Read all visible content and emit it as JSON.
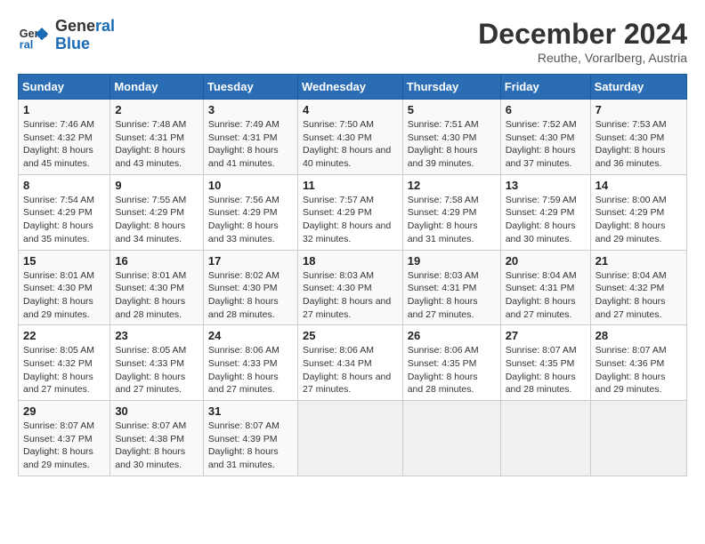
{
  "logo": {
    "line1": "General",
    "line2": "Blue"
  },
  "title": "December 2024",
  "subtitle": "Reuthe, Vorarlberg, Austria",
  "days_of_week": [
    "Sunday",
    "Monday",
    "Tuesday",
    "Wednesday",
    "Thursday",
    "Friday",
    "Saturday"
  ],
  "weeks": [
    [
      {
        "day": "1",
        "sunrise": "7:46 AM",
        "sunset": "4:32 PM",
        "daylight": "8 hours and 45 minutes."
      },
      {
        "day": "2",
        "sunrise": "7:48 AM",
        "sunset": "4:31 PM",
        "daylight": "8 hours and 43 minutes."
      },
      {
        "day": "3",
        "sunrise": "7:49 AM",
        "sunset": "4:31 PM",
        "daylight": "8 hours and 41 minutes."
      },
      {
        "day": "4",
        "sunrise": "7:50 AM",
        "sunset": "4:30 PM",
        "daylight": "8 hours and 40 minutes."
      },
      {
        "day": "5",
        "sunrise": "7:51 AM",
        "sunset": "4:30 PM",
        "daylight": "8 hours and 39 minutes."
      },
      {
        "day": "6",
        "sunrise": "7:52 AM",
        "sunset": "4:30 PM",
        "daylight": "8 hours and 37 minutes."
      },
      {
        "day": "7",
        "sunrise": "7:53 AM",
        "sunset": "4:30 PM",
        "daylight": "8 hours and 36 minutes."
      }
    ],
    [
      {
        "day": "8",
        "sunrise": "7:54 AM",
        "sunset": "4:29 PM",
        "daylight": "8 hours and 35 minutes."
      },
      {
        "day": "9",
        "sunrise": "7:55 AM",
        "sunset": "4:29 PM",
        "daylight": "8 hours and 34 minutes."
      },
      {
        "day": "10",
        "sunrise": "7:56 AM",
        "sunset": "4:29 PM",
        "daylight": "8 hours and 33 minutes."
      },
      {
        "day": "11",
        "sunrise": "7:57 AM",
        "sunset": "4:29 PM",
        "daylight": "8 hours and 32 minutes."
      },
      {
        "day": "12",
        "sunrise": "7:58 AM",
        "sunset": "4:29 PM",
        "daylight": "8 hours and 31 minutes."
      },
      {
        "day": "13",
        "sunrise": "7:59 AM",
        "sunset": "4:29 PM",
        "daylight": "8 hours and 30 minutes."
      },
      {
        "day": "14",
        "sunrise": "8:00 AM",
        "sunset": "4:29 PM",
        "daylight": "8 hours and 29 minutes."
      }
    ],
    [
      {
        "day": "15",
        "sunrise": "8:01 AM",
        "sunset": "4:30 PM",
        "daylight": "8 hours and 29 minutes."
      },
      {
        "day": "16",
        "sunrise": "8:01 AM",
        "sunset": "4:30 PM",
        "daylight": "8 hours and 28 minutes."
      },
      {
        "day": "17",
        "sunrise": "8:02 AM",
        "sunset": "4:30 PM",
        "daylight": "8 hours and 28 minutes."
      },
      {
        "day": "18",
        "sunrise": "8:03 AM",
        "sunset": "4:30 PM",
        "daylight": "8 hours and 27 minutes."
      },
      {
        "day": "19",
        "sunrise": "8:03 AM",
        "sunset": "4:31 PM",
        "daylight": "8 hours and 27 minutes."
      },
      {
        "day": "20",
        "sunrise": "8:04 AM",
        "sunset": "4:31 PM",
        "daylight": "8 hours and 27 minutes."
      },
      {
        "day": "21",
        "sunrise": "8:04 AM",
        "sunset": "4:32 PM",
        "daylight": "8 hours and 27 minutes."
      }
    ],
    [
      {
        "day": "22",
        "sunrise": "8:05 AM",
        "sunset": "4:32 PM",
        "daylight": "8 hours and 27 minutes."
      },
      {
        "day": "23",
        "sunrise": "8:05 AM",
        "sunset": "4:33 PM",
        "daylight": "8 hours and 27 minutes."
      },
      {
        "day": "24",
        "sunrise": "8:06 AM",
        "sunset": "4:33 PM",
        "daylight": "8 hours and 27 minutes."
      },
      {
        "day": "25",
        "sunrise": "8:06 AM",
        "sunset": "4:34 PM",
        "daylight": "8 hours and 27 minutes."
      },
      {
        "day": "26",
        "sunrise": "8:06 AM",
        "sunset": "4:35 PM",
        "daylight": "8 hours and 28 minutes."
      },
      {
        "day": "27",
        "sunrise": "8:07 AM",
        "sunset": "4:35 PM",
        "daylight": "8 hours and 28 minutes."
      },
      {
        "day": "28",
        "sunrise": "8:07 AM",
        "sunset": "4:36 PM",
        "daylight": "8 hours and 29 minutes."
      }
    ],
    [
      {
        "day": "29",
        "sunrise": "8:07 AM",
        "sunset": "4:37 PM",
        "daylight": "8 hours and 29 minutes."
      },
      {
        "day": "30",
        "sunrise": "8:07 AM",
        "sunset": "4:38 PM",
        "daylight": "8 hours and 30 minutes."
      },
      {
        "day": "31",
        "sunrise": "8:07 AM",
        "sunset": "4:39 PM",
        "daylight": "8 hours and 31 minutes."
      },
      null,
      null,
      null,
      null
    ]
  ]
}
